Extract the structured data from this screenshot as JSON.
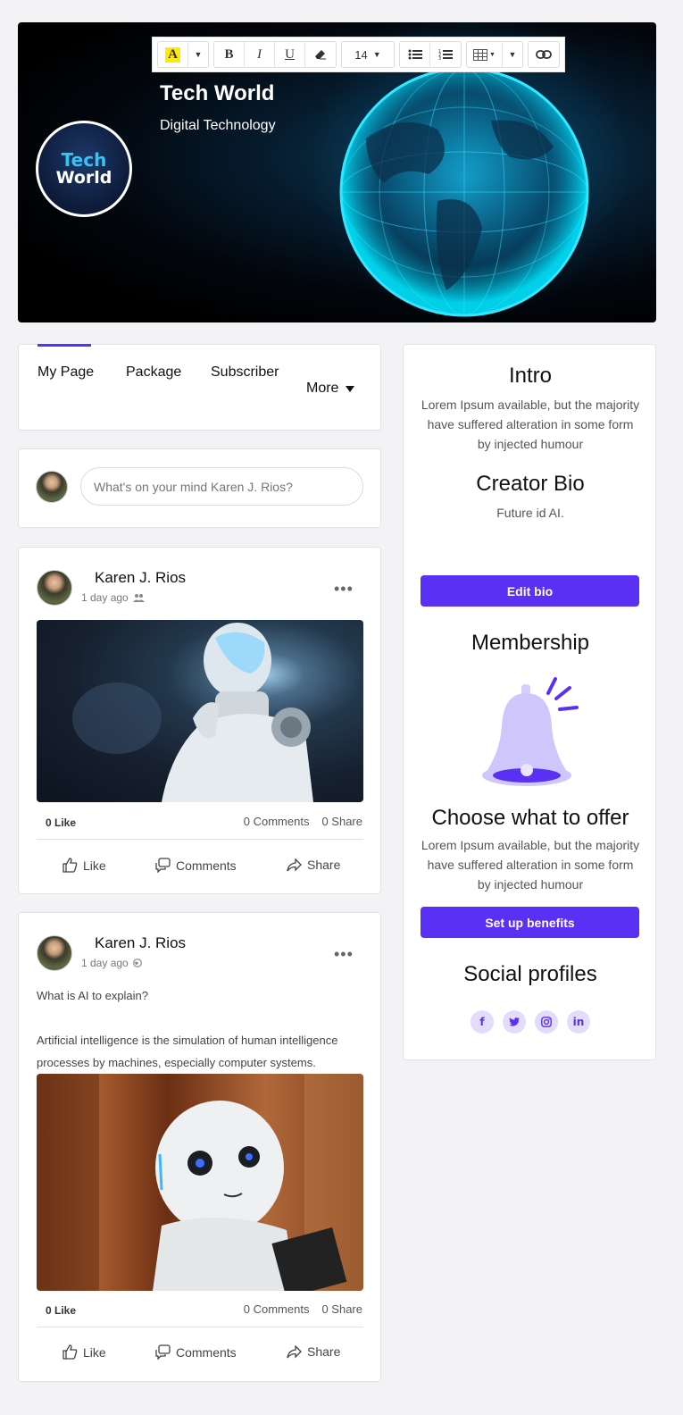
{
  "cover": {
    "title": "Tech World",
    "subtitle": "Digital Technology",
    "logo_line1": "Tech",
    "logo_line2": "World"
  },
  "toolbar": {
    "font_size": "14",
    "bold": "B",
    "italic": "I",
    "underline": "U",
    "highlight_letter": "A"
  },
  "tabs": {
    "items": [
      "My Page",
      "Package",
      "Subscriber"
    ],
    "more": "More"
  },
  "composer": {
    "placeholder": "What's on your mind Karen J. Rios?"
  },
  "posts": [
    {
      "author": "Karen J. Rios",
      "time": "1 day ago",
      "likes": "0 Like",
      "comments": "0  Comments",
      "shares": "0  Share",
      "actions": {
        "like": "Like",
        "comments": "Comments",
        "share": "Share"
      }
    },
    {
      "author": "Karen J. Rios",
      "time": "1 day ago",
      "text1": "What is AI to explain?",
      "text2": "Artificial intelligence is the simulation of human intelligence processes by machines, especially computer systems.",
      "likes": "0 Like",
      "comments": "0  Comments",
      "shares": "0  Share",
      "actions": {
        "like": "Like",
        "comments": "Comments",
        "share": "Share"
      }
    }
  ],
  "sidebar": {
    "intro_title": "Intro",
    "intro_text": "Lorem Ipsum available, but the majority have suffered alteration in some form by injected humour",
    "bio_title": "Creator Bio",
    "bio_text": "Future id AI.",
    "edit_bio": "Edit bio",
    "membership_title": "Membership",
    "offer_title": "Choose what to offer",
    "offer_text": "Lorem Ipsum available, but the majority have suffered alteration in some form by injected humour",
    "setup_benefits": "Set up benefits",
    "social_title": "Social profiles",
    "socials": [
      "facebook-icon",
      "twitter-icon",
      "instagram-icon",
      "linkedin-icon"
    ]
  },
  "colors": {
    "accent": "#5a30f5",
    "social_bg": "#e3ddfb"
  }
}
